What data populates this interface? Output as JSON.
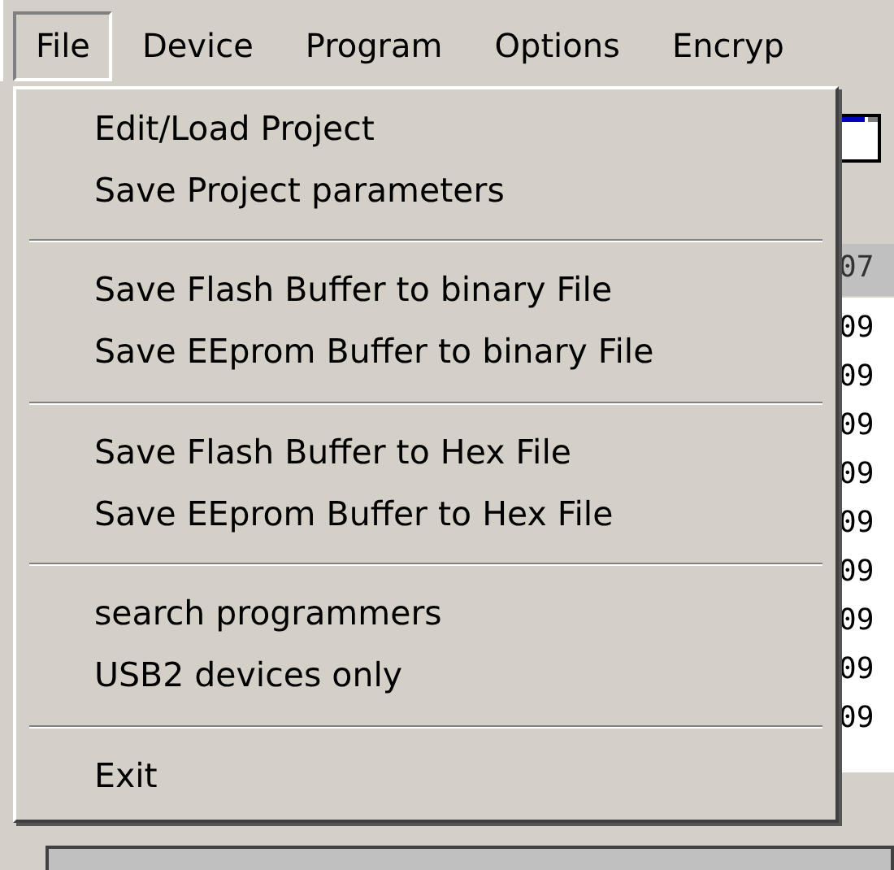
{
  "menu_bar": [
    {
      "label": "File",
      "selected": true
    },
    {
      "label": "Device",
      "selected": false
    },
    {
      "label": "Program",
      "selected": false
    },
    {
      "label": "Options",
      "selected": false
    },
    {
      "label": "Encryp",
      "selected": false
    }
  ],
  "file_menu": [
    {
      "kind": "item",
      "label": "Edit/Load Project"
    },
    {
      "kind": "item",
      "label": "Save Project parameters"
    },
    {
      "kind": "separator"
    },
    {
      "kind": "item",
      "label": "Save Flash Buffer to binary File"
    },
    {
      "kind": "item",
      "label": "Save EEprom Buffer to binary File"
    },
    {
      "kind": "separator"
    },
    {
      "kind": "item",
      "label": "Save Flash Buffer to Hex File"
    },
    {
      "kind": "item",
      "label": "Save EEprom Buffer to Hex File"
    },
    {
      "kind": "separator"
    },
    {
      "kind": "item",
      "label": "search programmers"
    },
    {
      "kind": "item",
      "label": "USB2 devices only"
    },
    {
      "kind": "separator"
    },
    {
      "kind": "item",
      "label": "Exit"
    }
  ],
  "hex_view": {
    "header": "07",
    "cells": [
      "09",
      "09",
      "09",
      "09",
      "09",
      "09",
      "09",
      "09",
      "09"
    ]
  }
}
